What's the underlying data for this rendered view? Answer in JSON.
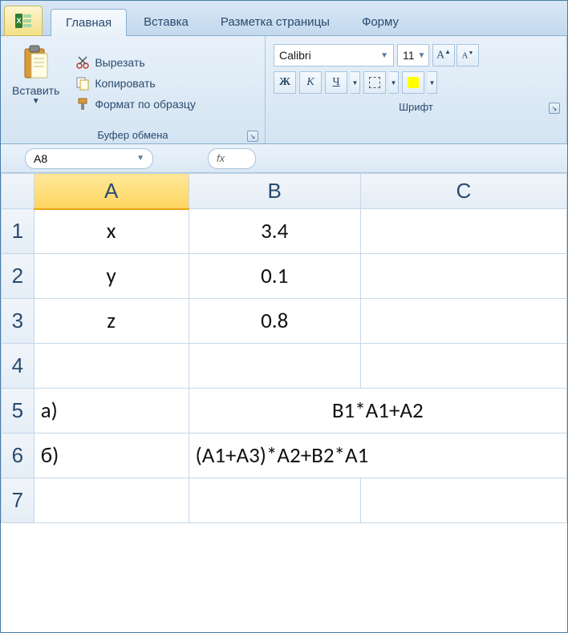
{
  "tabs": {
    "home": "Главная",
    "insert": "Вставка",
    "page_layout": "Разметка страницы",
    "formulas": "Форму"
  },
  "clipboard": {
    "paste": "Вставить",
    "cut": "Вырезать",
    "copy": "Копировать",
    "format_painter": "Формат по образцу",
    "group_label": "Буфер обмена"
  },
  "font": {
    "name": "Calibri",
    "size": "11",
    "bold": "Ж",
    "italic": "К",
    "underline": "Ч",
    "group_label": "Шрифт"
  },
  "namebox": "A8",
  "fx_label": "fx",
  "columns": [
    "A",
    "B",
    "C"
  ],
  "rows": [
    "1",
    "2",
    "3",
    "4",
    "5",
    "6",
    "7"
  ],
  "cells": {
    "A1": "x",
    "B1": "3.4",
    "A2": "y",
    "B2": "0.1",
    "A3": "z",
    "B3": "0.8",
    "A5": "а)",
    "B5C5": "B1*A1+A2",
    "A6": "б)",
    "B6C6": "(A1+A3)*A2+B2*A1"
  }
}
